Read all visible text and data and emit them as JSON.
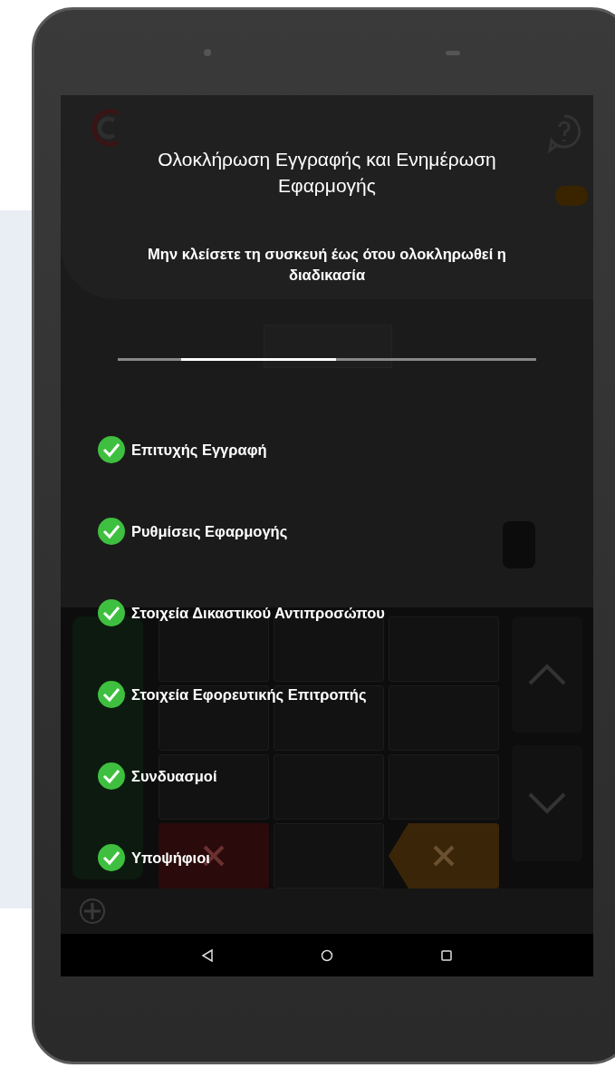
{
  "dialog": {
    "title": "Ολοκλήρωση Εγγραφής και Ενημέρωση Εφαρμογής",
    "message": "Μην κλείσετε τη συσκευή έως ότου ολοκληρωθεί η διαδικασία",
    "progress": {
      "level": 0.37
    },
    "steps": [
      {
        "label": "Επιτυχής Εγγραφή",
        "done": true
      },
      {
        "label": "Ρυθμίσεις Εφαρμογής",
        "done": true
      },
      {
        "label": "Στοιχεία Δικαστικού Αντιπροσώπου",
        "done": true
      },
      {
        "label": "Στοιχεία Εφορευτικής Επιτροπής",
        "done": true
      },
      {
        "label": "Συνδυασμοί",
        "done": true
      },
      {
        "label": "Υποψήφιοι",
        "done": true
      }
    ]
  }
}
